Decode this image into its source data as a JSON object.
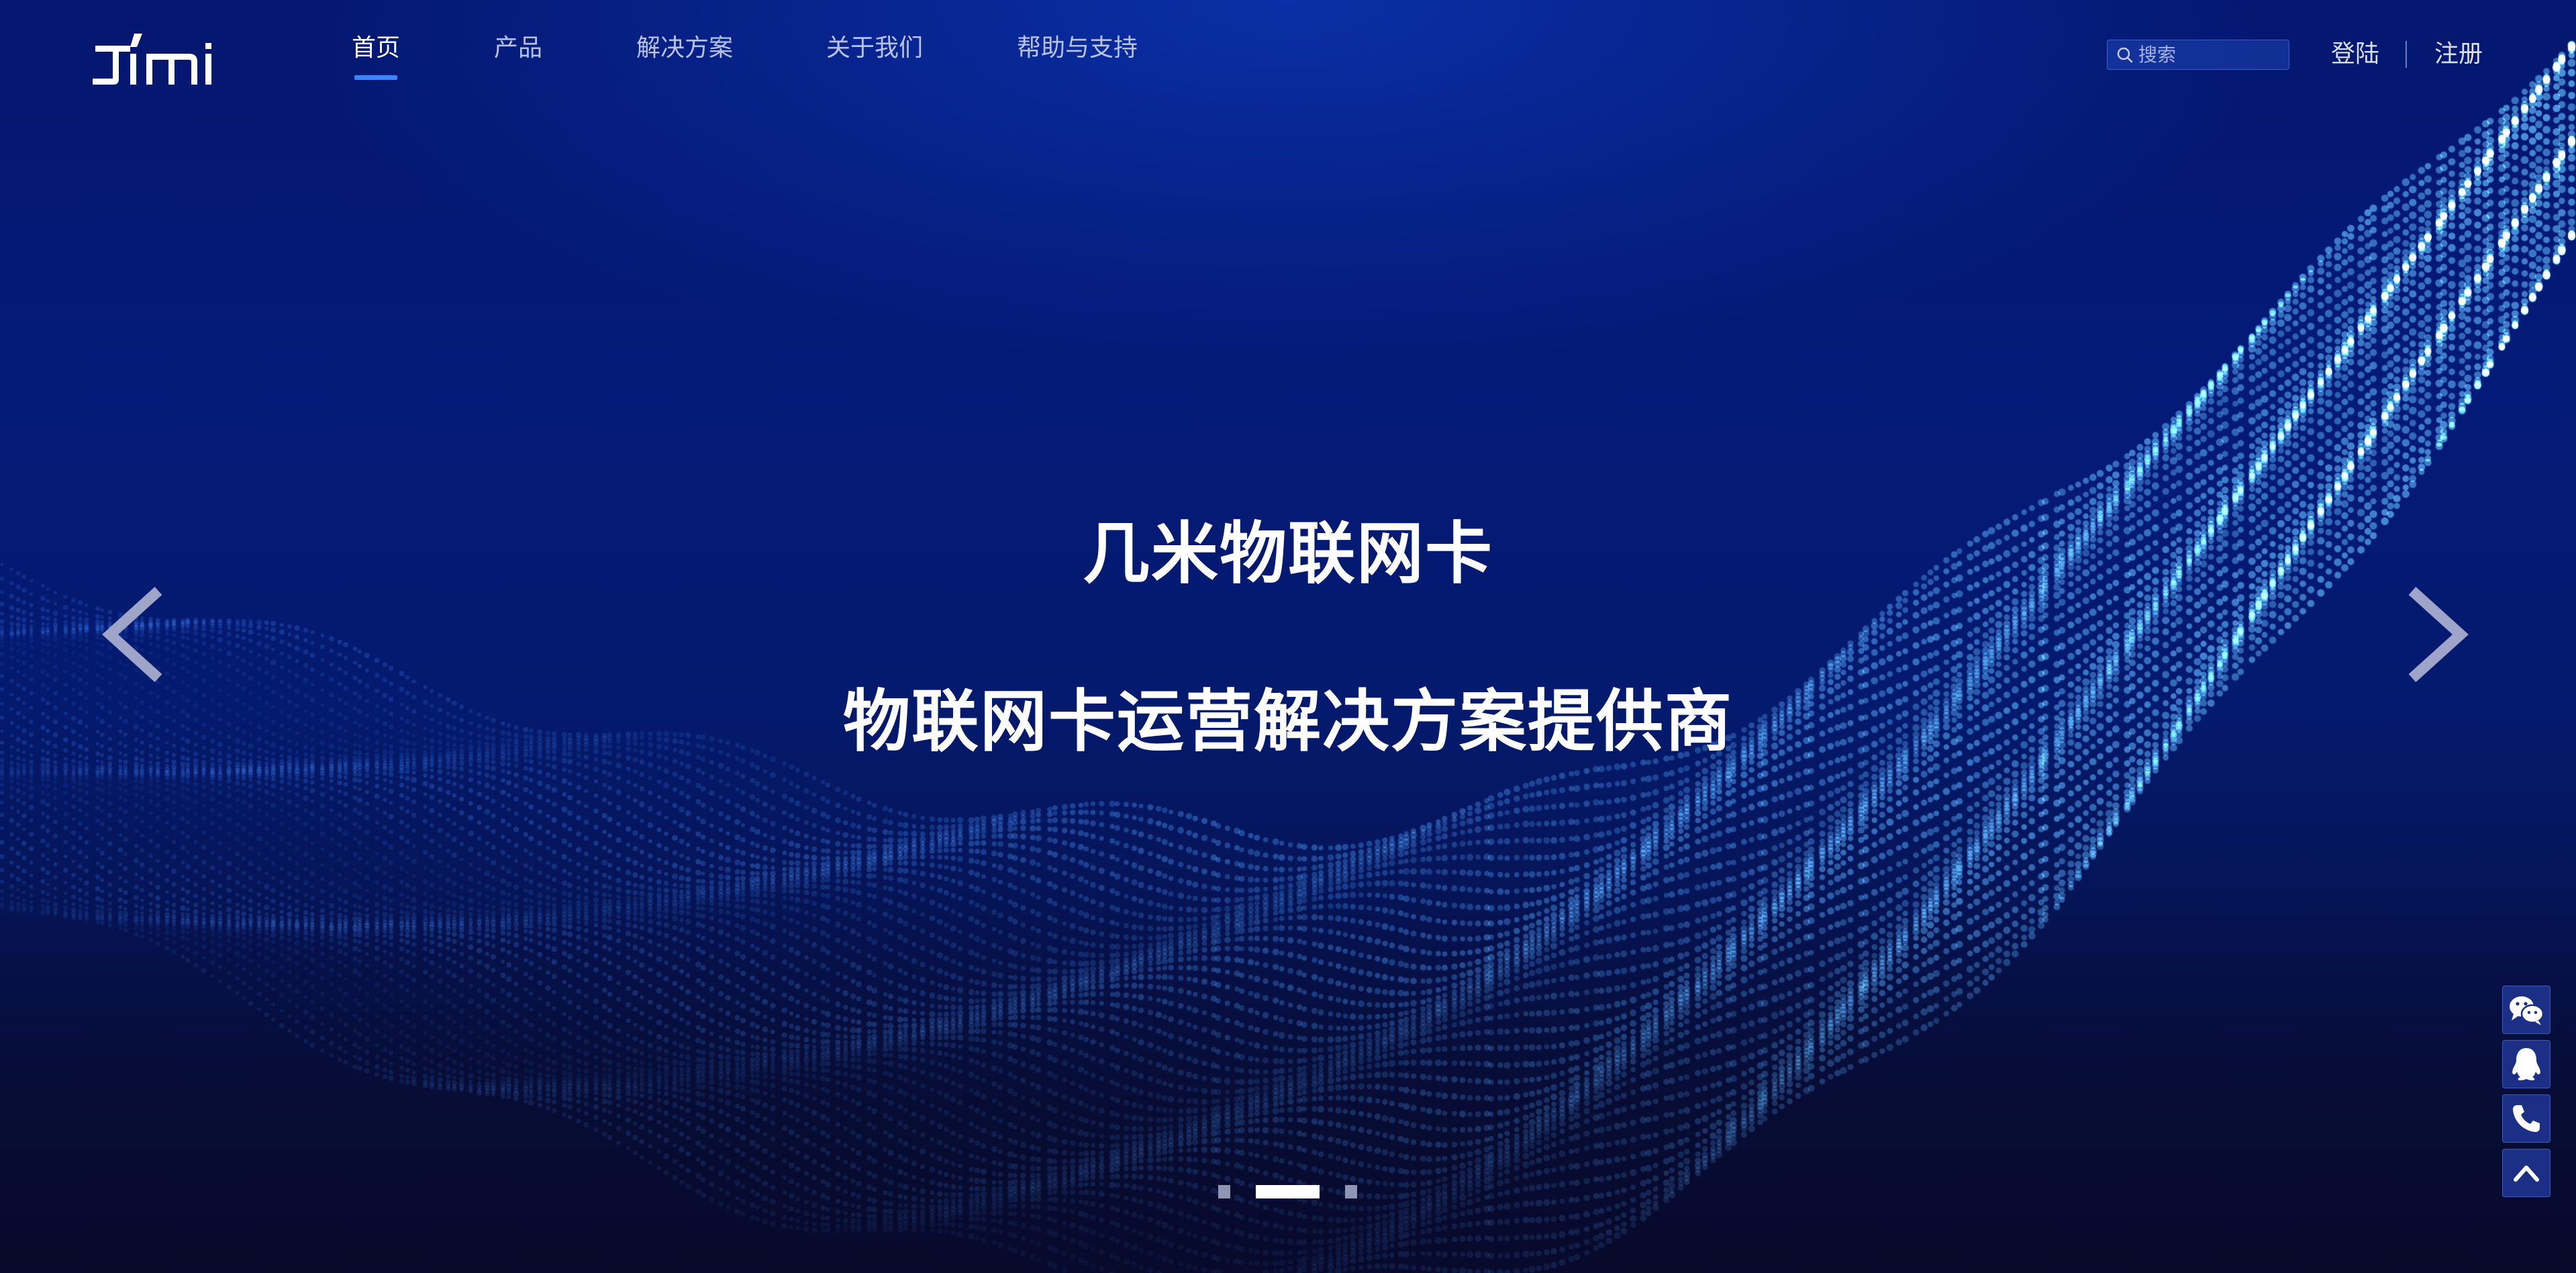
{
  "brand": {
    "logo_text": "JIMI"
  },
  "nav": {
    "items": [
      {
        "label": "首页",
        "active": true
      },
      {
        "label": "产品",
        "active": false
      },
      {
        "label": "解决方案",
        "active": false
      },
      {
        "label": "关于我们",
        "active": false
      },
      {
        "label": "帮助与支持",
        "active": false
      }
    ]
  },
  "search": {
    "placeholder": "搜索",
    "value": ""
  },
  "auth": {
    "login_label": "登陆",
    "register_label": "注册"
  },
  "hero": {
    "title": "几米物联网卡",
    "subtitle": "物联网卡运营解决方案提供商"
  },
  "carousel": {
    "slide_count": 3,
    "active_index": 1
  },
  "side_buttons": [
    "wechat-icon",
    "qq-icon",
    "phone-icon",
    "back-to-top-icon"
  ],
  "colors": {
    "accent": "#3b86ff",
    "background_top": "#041770",
    "background_bottom": "#080b2e",
    "particle": "#4aa3ff"
  }
}
